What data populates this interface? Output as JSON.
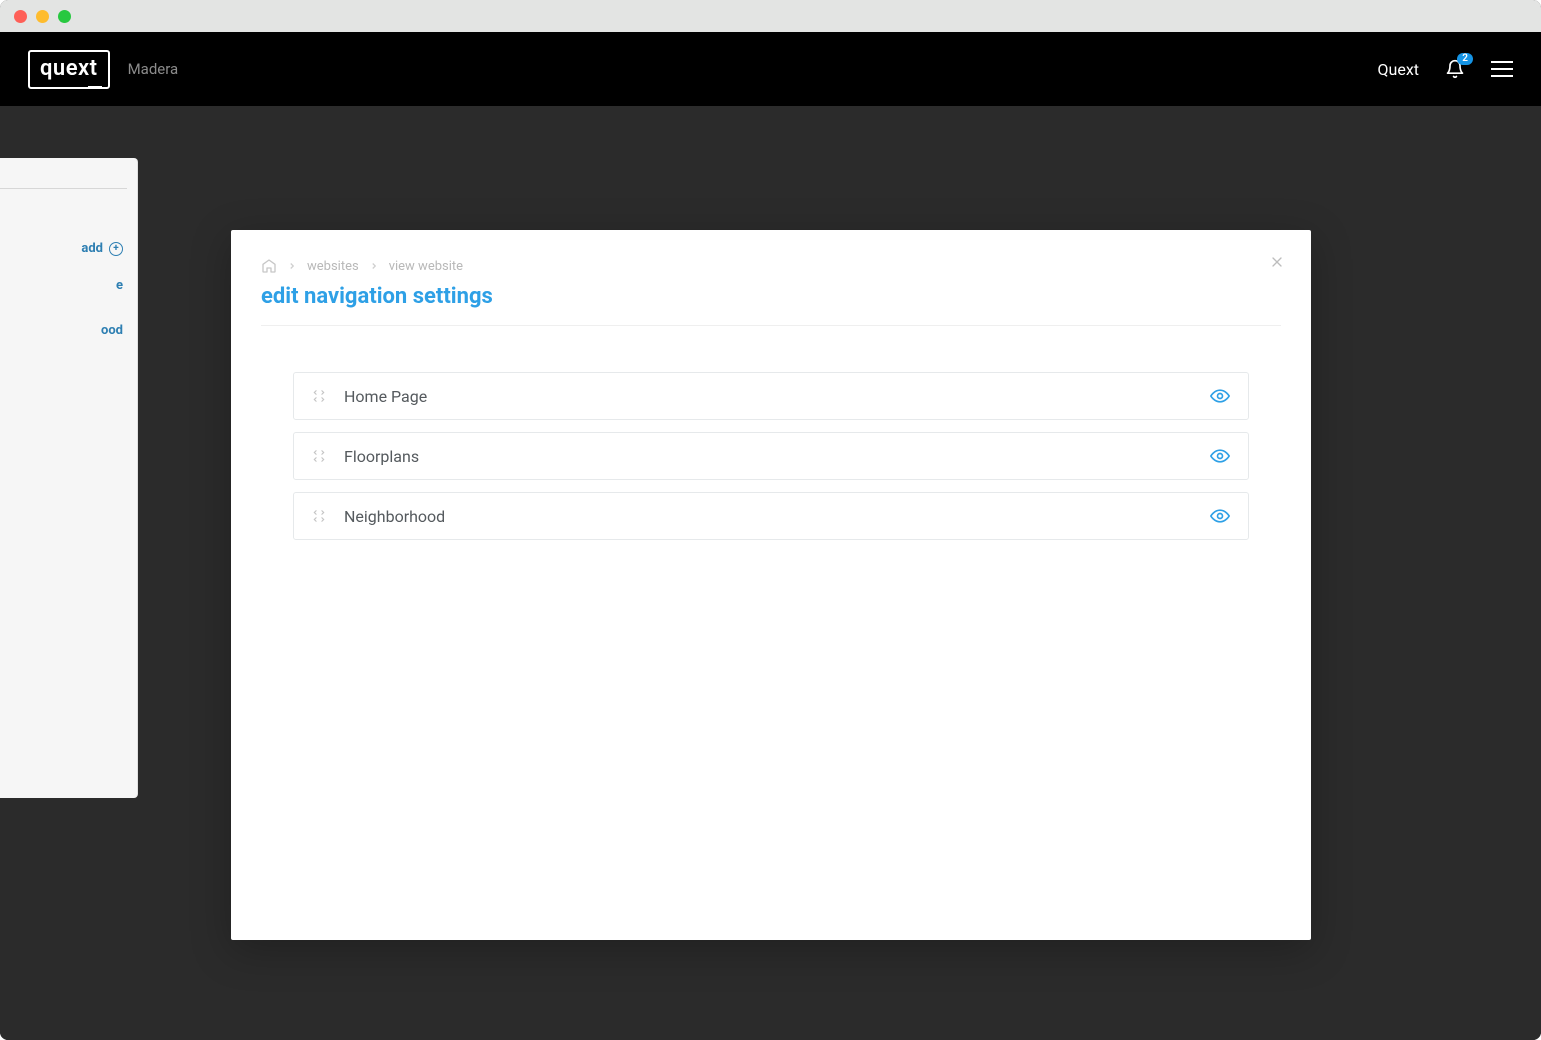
{
  "header": {
    "logo_text": "quext",
    "context_label": "Madera",
    "user_label": "Quext",
    "notification_count": "2"
  },
  "background_sidebar": {
    "add_label": "add",
    "items": [
      "e",
      "ood"
    ]
  },
  "modal": {
    "breadcrumbs": {
      "crumb1": "websites",
      "crumb2": "view website"
    },
    "title": "edit navigation settings",
    "nav_items": [
      {
        "label": "Home Page"
      },
      {
        "label": "Floorplans"
      },
      {
        "label": "Neighborhood"
      }
    ]
  }
}
